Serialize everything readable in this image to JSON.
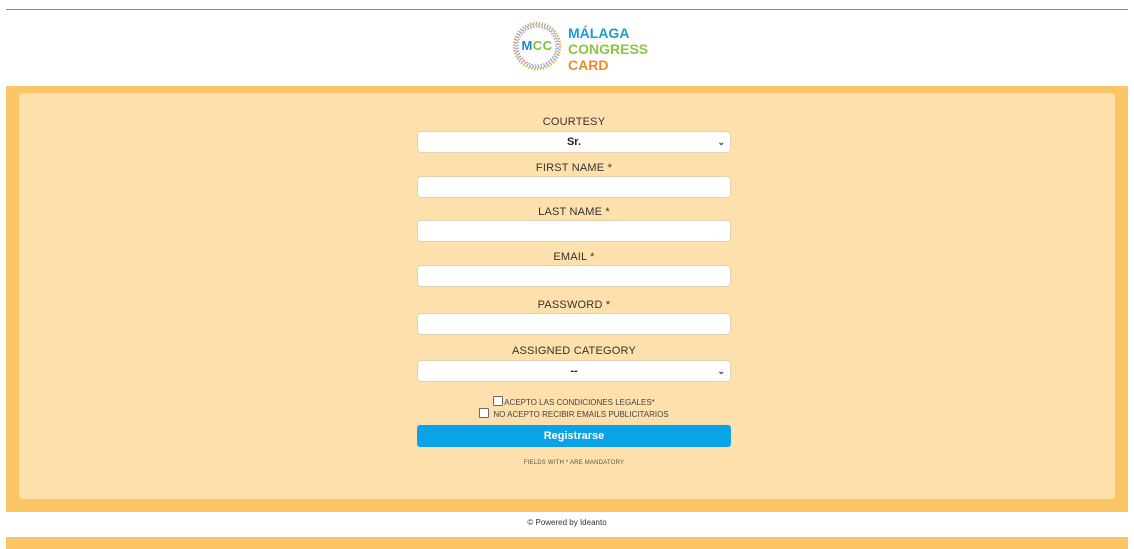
{
  "header": {
    "logo": {
      "mark_text_left": "M",
      "mark_text_right": "CC",
      "line1": "MÁLAGA",
      "line2": "CONGRESS",
      "line3": "CARD",
      "colors": {
        "blue": "#1f9ad6",
        "green": "#8cc63f",
        "orange": "#f08a24"
      }
    }
  },
  "form": {
    "courtesy": {
      "label": "COURTESY",
      "value": "Sr."
    },
    "first_name": {
      "label": "FIRST NAME *",
      "value": ""
    },
    "last_name": {
      "label": "LAST NAME *",
      "value": ""
    },
    "email": {
      "label": "EMAIL *",
      "value": ""
    },
    "password": {
      "label": "PASSWORD *",
      "value": ""
    },
    "assigned_category": {
      "label": "ASSIGNED CATEGORY",
      "value": "--"
    },
    "checkbox_legal": {
      "label": "ACEPTO LAS CONDICIONES LEGALES*",
      "checked": false
    },
    "checkbox_emails": {
      "label": "NO ACEPTO RECIBIR EMAILS PUBLICITARIOS",
      "checked": false
    },
    "submit_label": "Registrarse",
    "mandatory_note": "FIELDS WITH * ARE MANDATORY"
  },
  "footer": {
    "text": "© Powered by Ideanto"
  },
  "colors": {
    "frame": "#fcc565",
    "panel": "#fde0ab",
    "button": "#0aa3e8"
  }
}
